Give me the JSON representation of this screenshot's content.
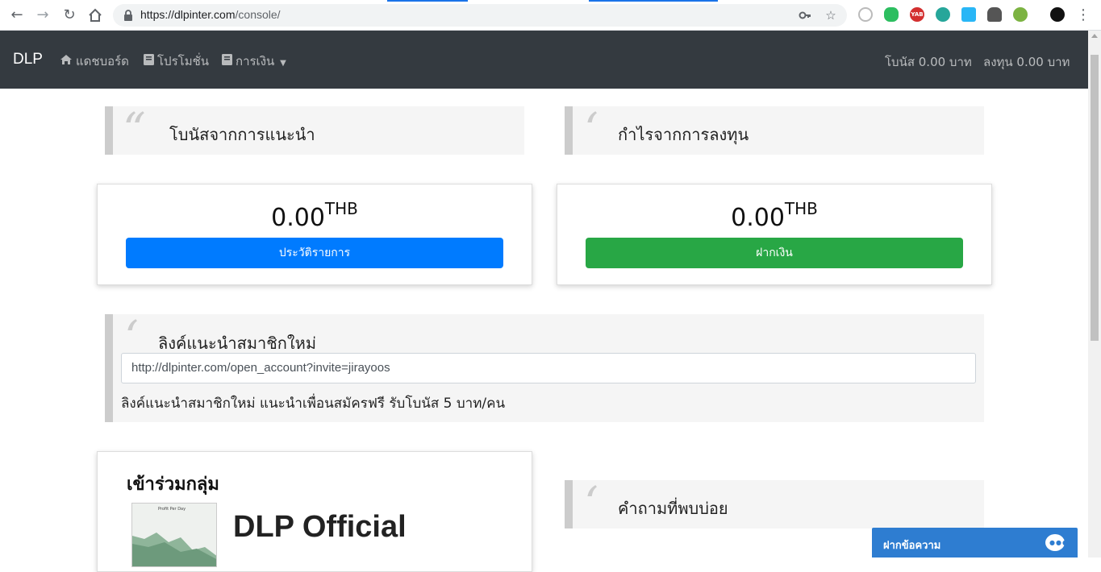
{
  "browser": {
    "url_host": "https://dlpinter.com",
    "url_path": "/console/",
    "extensions": [
      "blocked-icon",
      "evernote-icon",
      "yab-icon",
      "gear-ext-icon",
      "share-ext-icon",
      "ghost-ext-icon",
      "globe-ext-icon",
      "profile-avatar-icon"
    ],
    "ext_yab_label": "YAB"
  },
  "navbar": {
    "brand": "DLP",
    "items": [
      {
        "label": "แดชบอร์ด",
        "icon": "home-icon"
      },
      {
        "label": "โปรโมชั่น",
        "icon": "book-icon"
      },
      {
        "label": "การเงิน",
        "icon": "book-icon"
      }
    ],
    "bonus": "โบนัส 0.00 บาท",
    "invest": "ลงทุน 0.00 บาท"
  },
  "sections": {
    "referral_bonus_title": "โบนัสจากการแนะนำ",
    "investment_profit_title": "กำไรจากการลงทุน",
    "referral_link_title": "ลิงค์แนะนำสมาชิกใหม่",
    "faq_title": "คำถามที่พบบ่อย"
  },
  "cards": {
    "bonus_amount": "0.00",
    "bonus_currency": "THB",
    "bonus_button": "ประวัติรายการ",
    "profit_amount": "0.00",
    "profit_currency": "THB",
    "profit_button": "ฝากเงิน"
  },
  "referral": {
    "link": "http://dlpinter.com/open_account?invite=jirayoos",
    "note": "ลิงค์แนะนำสมาชิกใหม่ แนะนำเพื่อนสมัครฟรี รับโบนัส 5 บาท/คน"
  },
  "group": {
    "title": "เข้าร่วมกลุ่ม",
    "name": "DLP Official",
    "thumb_caption": "Profit Per Day"
  },
  "chat": {
    "label": "ฝากข้อความ"
  },
  "colors": {
    "navbar": "#343a40",
    "primary": "#007bff",
    "success": "#28a745",
    "chat": "#2e7dd1"
  }
}
